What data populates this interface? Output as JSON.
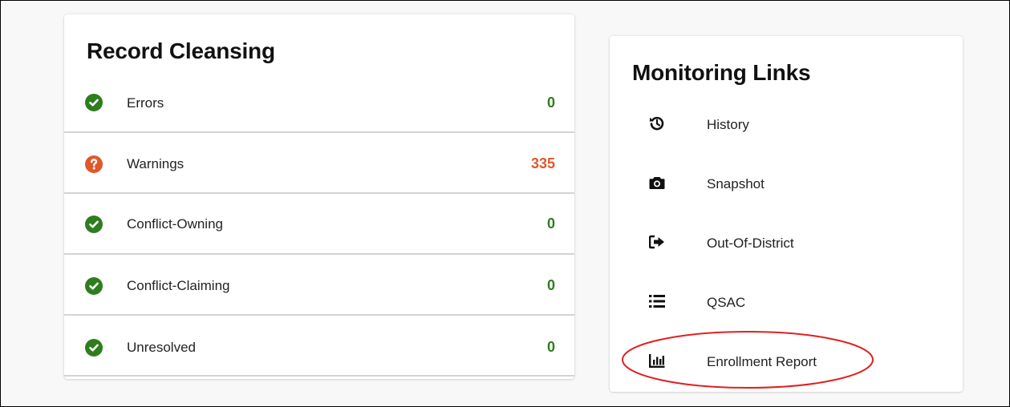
{
  "record_cleansing": {
    "title": "Record Cleansing",
    "rows": [
      {
        "label": "Errors",
        "count": "0",
        "status": "ok"
      },
      {
        "label": "Warnings",
        "count": "335",
        "status": "warning"
      },
      {
        "label": "Conflict-Owning",
        "count": "0",
        "status": "ok"
      },
      {
        "label": "Conflict-Claiming",
        "count": "0",
        "status": "ok"
      },
      {
        "label": "Unresolved",
        "count": "0",
        "status": "ok"
      }
    ]
  },
  "monitoring_links": {
    "title": "Monitoring Links",
    "items": [
      {
        "label": "History",
        "icon": "history-icon"
      },
      {
        "label": "Snapshot",
        "icon": "camera-icon"
      },
      {
        "label": "Out-Of-District",
        "icon": "sign-out-icon"
      },
      {
        "label": "QSAC",
        "icon": "list-icon"
      },
      {
        "label": "Enrollment Report",
        "icon": "bar-chart-icon"
      }
    ]
  },
  "colors": {
    "ok": "#2e7d1f",
    "warning": "#e0582a",
    "annotation": "#e02020"
  }
}
